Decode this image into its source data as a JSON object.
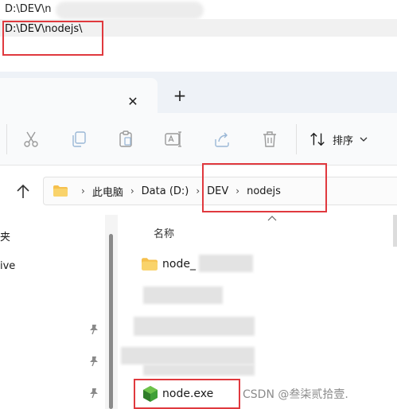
{
  "top": {
    "path_partial": "D:\\DEV\\n",
    "path_full": "D:\\DEV\\nodejs\\"
  },
  "tabs": {
    "close_glyph": "✕",
    "new_glyph": "+"
  },
  "toolbar": {
    "sort_label": "排序",
    "icons": [
      "cut-icon",
      "copy-icon",
      "paste-icon",
      "rename-icon",
      "share-icon",
      "delete-icon",
      "sort-icon",
      "chevron-down-icon"
    ]
  },
  "address": {
    "crumbs": [
      "此电脑",
      "Data (D:)",
      "DEV",
      "nodejs"
    ],
    "separator": "›"
  },
  "nav": {
    "items": [
      "夹",
      "ive"
    ]
  },
  "list": {
    "column_name": "名称",
    "files": [
      {
        "name": "node_",
        "icon": "folder-icon"
      },
      {
        "name": "node.exe",
        "icon": "node-exe-icon"
      }
    ]
  },
  "watermark": "CSDN @叁柒贰拾壹.",
  "colors": {
    "highlight": "#e0393e",
    "folder": "#f6c04d",
    "node_green": "#3fa037"
  }
}
